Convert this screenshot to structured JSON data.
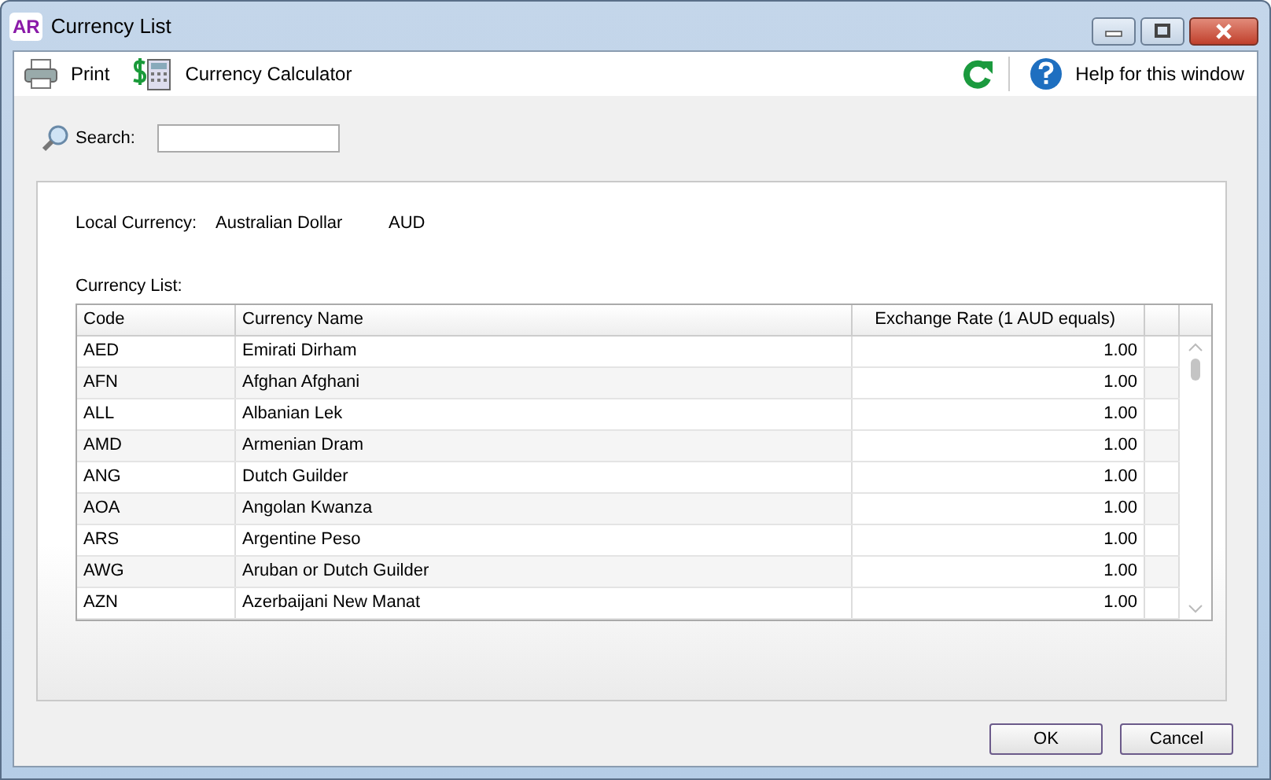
{
  "window": {
    "app_badge": "AR",
    "title": "Currency List"
  },
  "toolbar": {
    "print": "Print",
    "calculator": "Currency Calculator",
    "help": "Help for this window"
  },
  "search": {
    "label": "Search:"
  },
  "local_currency": {
    "label": "Local Currency:",
    "name": "Australian Dollar",
    "code": "AUD"
  },
  "table": {
    "caption": "Currency List:",
    "columns": [
      "Code",
      "Currency Name",
      "Exchange Rate (1 AUD equals)"
    ],
    "rows": [
      {
        "code": "AED",
        "name": "Emirati Dirham",
        "rate": "1.00"
      },
      {
        "code": "AFN",
        "name": "Afghan Afghani",
        "rate": "1.00"
      },
      {
        "code": "ALL",
        "name": "Albanian Lek",
        "rate": "1.00"
      },
      {
        "code": "AMD",
        "name": "Armenian Dram",
        "rate": "1.00"
      },
      {
        "code": "ANG",
        "name": "Dutch Guilder",
        "rate": "1.00"
      },
      {
        "code": "AOA",
        "name": "Angolan Kwanza",
        "rate": "1.00"
      },
      {
        "code": "ARS",
        "name": "Argentine Peso",
        "rate": "1.00"
      },
      {
        "code": "AWG",
        "name": "Aruban or Dutch Guilder",
        "rate": "1.00"
      },
      {
        "code": "AZN",
        "name": "Azerbaijani New Manat",
        "rate": "1.00"
      }
    ]
  },
  "buttons": [
    "OK",
    "Cancel"
  ]
}
